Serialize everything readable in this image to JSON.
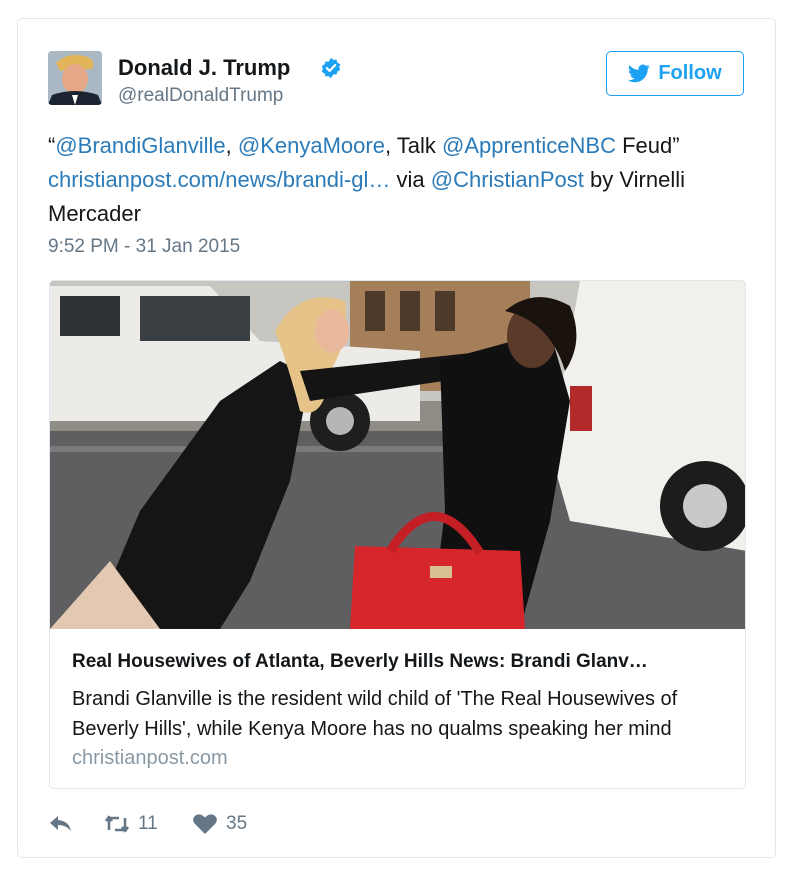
{
  "author": {
    "name": "Donald J. Trump",
    "handle": "@realDonaldTrump",
    "verified": true
  },
  "follow_button": {
    "label": "Follow"
  },
  "tweet": {
    "parts": {
      "q_open": "“",
      "m1": "@BrandiGlanville",
      "c1": ", ",
      "m2": "@KenyaMoore",
      "c2": ", Talk ",
      "m3": "@ApprenticeNBC",
      "c3": " Feud” ",
      "link": "christianpost.com/news/brandi-gl…",
      "c4": " via ",
      "m4": "@ChristianPost",
      "c5": " by Virnelli Mercader"
    },
    "timestamp": "9:52 PM - 31 Jan 2015"
  },
  "card": {
    "title": "Real Housewives of Atlanta, Beverly Hills News: Brandi Glanv…",
    "description": "Brandi Glanville is the resident wild child of 'The Real Housewives of Beverly Hills', while Kenya Moore has no qualms speaking her mind",
    "domain": "christianpost.com"
  },
  "actions": {
    "retweets": "11",
    "likes": "35"
  },
  "colors": {
    "accent": "#1da1f2",
    "link": "#2b7bb9",
    "muted": "#657786"
  }
}
